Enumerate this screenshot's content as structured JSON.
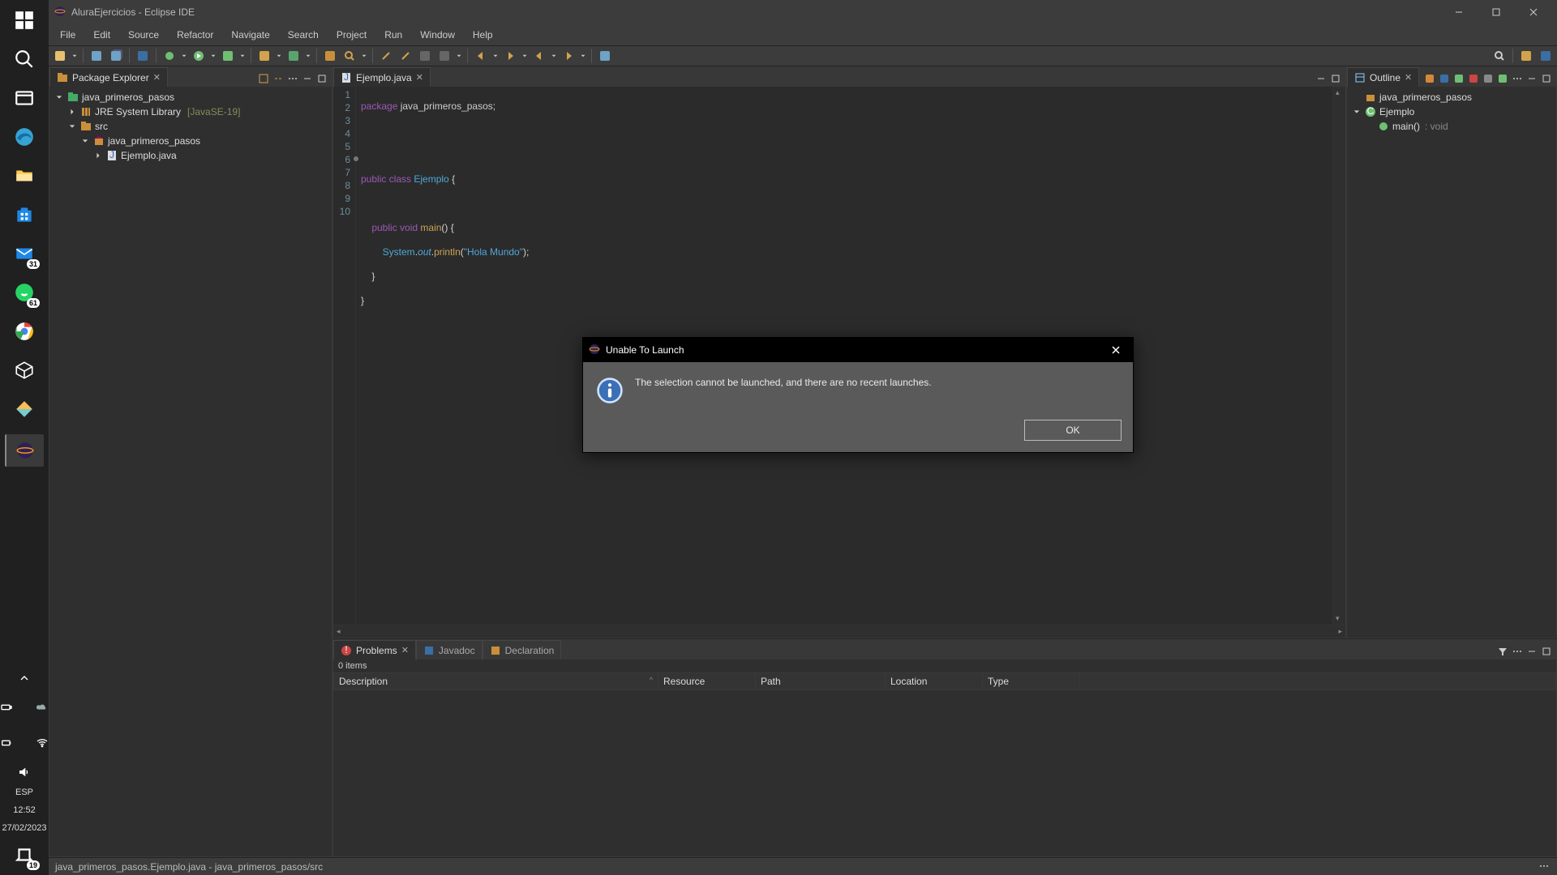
{
  "taskbar": {
    "mail_badge": "31",
    "whatsapp_badge": "61",
    "notif_badge": "19",
    "lang": "ESP",
    "time": "12:52",
    "date": "27/02/2023"
  },
  "titlebar": {
    "title": "AluraEjercicios - Eclipse IDE"
  },
  "menu": [
    "File",
    "Edit",
    "Source",
    "Refactor",
    "Navigate",
    "Search",
    "Project",
    "Run",
    "Window",
    "Help"
  ],
  "package_explorer": {
    "title": "Package Explorer",
    "project": "java_primeros_pasos",
    "jre": "JRE System Library",
    "jre_ver": "[JavaSE-19]",
    "src": "src",
    "pkg": "java_primeros_pasos",
    "file": "Ejemplo.java"
  },
  "editor": {
    "tab": "Ejemplo.java",
    "lines": [
      "1",
      "2",
      "3",
      "4",
      "5",
      "6",
      "7",
      "8",
      "9",
      "10"
    ],
    "marker_line": "6",
    "code": {
      "l1a": "package",
      "l1b": " java_primeros_pasos;",
      "l4a": "public",
      "l4b": " class",
      "l4c": " Ejemplo",
      "l4d": " {",
      "l6a": "    public",
      "l6b": " void",
      "l6c": " main",
      "l6d": "() {",
      "l7a": "        System",
      "l7b": ".",
      "l7c": "out",
      "l7d": ".",
      "l7e": "println",
      "l7f": "(",
      "l7g": "\"Hola Mundo\"",
      "l7h": ");",
      "l8": "    }",
      "l9": "}"
    }
  },
  "outline": {
    "title": "Outline",
    "pkg": "java_primeros_pasos",
    "cls": "Ejemplo",
    "method": "main()",
    "ret": " : void"
  },
  "problems": {
    "tabs": [
      "Problems",
      "Javadoc",
      "Declaration"
    ],
    "count": "0 items",
    "cols": [
      "Description",
      "Resource",
      "Path",
      "Location",
      "Type"
    ]
  },
  "statusbar": {
    "path": "java_primeros_pasos.Ejemplo.java - java_primeros_pasos/src"
  },
  "dialog": {
    "title": "Unable To Launch",
    "message": "The selection cannot be launched, and there are no recent launches.",
    "ok": "OK"
  }
}
